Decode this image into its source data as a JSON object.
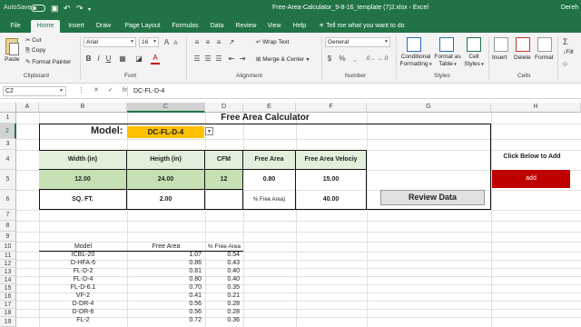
{
  "title_bar": {
    "autosave": "AutoSave",
    "autosave_state": "Off",
    "document_title": "Free-Area-Calculator_9-8-16_template (7)2.xlsx  -  Excel",
    "user": "Dereh"
  },
  "tabs": [
    "File",
    "Home",
    "Insert",
    "Draw",
    "Page Layout",
    "Formulas",
    "Data",
    "Review",
    "View",
    "Help"
  ],
  "active_tab": "Home",
  "tell_me": "Tell me what you want to do",
  "ribbon": {
    "clipboard": {
      "paste": "Paste",
      "cut": "Cut",
      "copy": "Copy",
      "format_painter": "Format Painter",
      "label": "Clipboard"
    },
    "font": {
      "name": "Arial",
      "size": "16",
      "bold": "B",
      "italic": "I",
      "underline": "U",
      "grow": "A",
      "shrink": "A",
      "font_color": "A",
      "label": "Font"
    },
    "alignment": {
      "wrap": "Wrap Text",
      "merge": "Merge & Center",
      "label": "Alignment"
    },
    "number": {
      "format": "General",
      "currency": "$",
      "percent": "%",
      "comma": ",",
      "label": "Number"
    },
    "styles": {
      "conditional": "Conditional Formatting",
      "format_table": "Format as Table",
      "cell_styles": "Cell Styles",
      "label": "Styles"
    },
    "cells": {
      "insert": "Insert",
      "delete": "Delete",
      "format": "Format",
      "label": "Cells"
    },
    "editing": {
      "autosum": "Σ",
      "fill": "Fill",
      "clear": ""
    }
  },
  "formula_bar": {
    "name_box": "C2",
    "fx": "fx",
    "content": "DC-FL-D-4"
  },
  "columns": [
    "A",
    "B",
    "C",
    "D",
    "E",
    "F",
    "G",
    "H"
  ],
  "rows": [
    "1",
    "2",
    "3",
    "4",
    "5",
    "6",
    "7",
    "8",
    "9",
    "10",
    "11",
    "12",
    "13",
    "14",
    "15",
    "16",
    "17",
    "18",
    "19"
  ],
  "sheet": {
    "title": "Free Area Calculator",
    "model_label": "Model:",
    "model_value": "DC-FL-D-4",
    "headers": {
      "width": "Width (in)",
      "height": "Heigth (in)",
      "cfm": "CFM",
      "free_area": "Free Area",
      "velocity": "Free Area Velociy"
    },
    "inputs": {
      "width": "12.00",
      "height": "24.00",
      "cfm": "12",
      "free_area": "0.80",
      "velocity": "15.00"
    },
    "sq_ft_label": "SQ. FT.",
    "sq_ft_value": "2.00",
    "pct_free_label": "% Free Area)",
    "pct_free_value": "40.00",
    "click_below": "Click Below to Add",
    "add_button": "add",
    "review_button": "Review Data",
    "list_headers": {
      "model": "Model",
      "free_area": "Free Area",
      "pct": "% Free Area"
    },
    "list": [
      {
        "model": "ICBL-20",
        "free_area": "1.07",
        "pct": "0.54"
      },
      {
        "model": "D-HFA-6",
        "free_area": "0.86",
        "pct": "0.43"
      },
      {
        "model": "FL-D-2",
        "free_area": "0.81",
        "pct": "0.40"
      },
      {
        "model": "FL-D-4",
        "free_area": "0.80",
        "pct": "0.40"
      },
      {
        "model": "FL-D-6.1",
        "free_area": "0.70",
        "pct": "0.35"
      },
      {
        "model": "VF-2",
        "free_area": "0.41",
        "pct": "0.21"
      },
      {
        "model": "D-DR-4",
        "free_area": "0.56",
        "pct": "0.28"
      },
      {
        "model": "D-DR-6",
        "free_area": "0.56",
        "pct": "0.28"
      },
      {
        "model": "FL-2",
        "free_area": "0.72",
        "pct": "0.36"
      }
    ]
  },
  "colors": {
    "excel_green": "#217346",
    "model_highlight": "#ffc000",
    "add_red": "#c00000",
    "header_green": "#e2efda",
    "input_green": "#c6e0b4"
  }
}
